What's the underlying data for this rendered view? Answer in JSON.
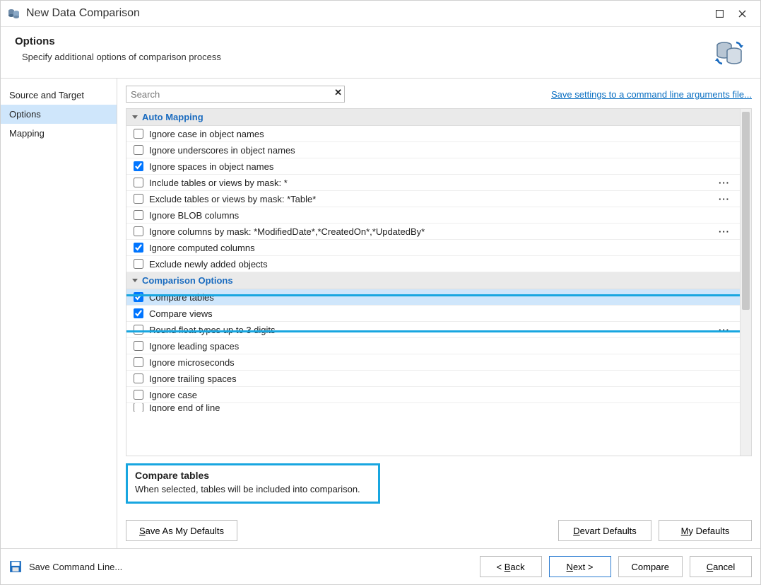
{
  "window": {
    "title": "New Data Comparison"
  },
  "header": {
    "title": "Options",
    "description": "Specify additional options of comparison process"
  },
  "sidenav": {
    "items": [
      {
        "label": "Source and Target",
        "active": false
      },
      {
        "label": "Options",
        "active": true
      },
      {
        "label": "Mapping",
        "active": false
      }
    ]
  },
  "search": {
    "placeholder": "Search"
  },
  "link_save_settings": "Save settings to a command line arguments file...",
  "groups": [
    {
      "title": "Auto Mapping",
      "items": [
        {
          "label": "Ignore case in object names",
          "checked": false
        },
        {
          "label": "Ignore underscores in object names",
          "checked": false
        },
        {
          "label": "Ignore spaces in object names",
          "checked": true
        },
        {
          "label": "Include tables or views by mask: *",
          "checked": false,
          "more": true
        },
        {
          "label": "Exclude tables or views by mask: *Table*",
          "checked": false,
          "more": true
        },
        {
          "label": "Ignore BLOB columns",
          "checked": false
        },
        {
          "label": "Ignore columns by mask: *ModifiedDate*,*CreatedOn*,*UpdatedBy*",
          "checked": false,
          "more": true
        },
        {
          "label": "Ignore computed columns",
          "checked": true
        },
        {
          "label": "Exclude newly added objects",
          "checked": false
        }
      ]
    },
    {
      "title": "Comparison Options",
      "items": [
        {
          "label": "Compare tables",
          "checked": true,
          "selected": true
        },
        {
          "label": "Compare views",
          "checked": true
        },
        {
          "label": "Round float types up to 3 digits",
          "checked": false,
          "more": true
        },
        {
          "label": "Ignore leading spaces",
          "checked": false
        },
        {
          "label": "Ignore microseconds",
          "checked": false
        },
        {
          "label": "Ignore trailing spaces",
          "checked": false
        },
        {
          "label": "Ignore case",
          "checked": false
        },
        {
          "label": "Ignore end of line",
          "checked": false
        }
      ]
    }
  ],
  "description_panel": {
    "title": "Compare tables",
    "text": "When selected, tables will be included into comparison."
  },
  "buttons": {
    "save_defaults": "Save As My Defaults",
    "devart_defaults": "Devart Defaults",
    "my_defaults": "My Defaults",
    "save_cmd": "Save Command Line...",
    "back": "< Back",
    "next": "Next >",
    "compare": "Compare",
    "cancel": "Cancel"
  }
}
